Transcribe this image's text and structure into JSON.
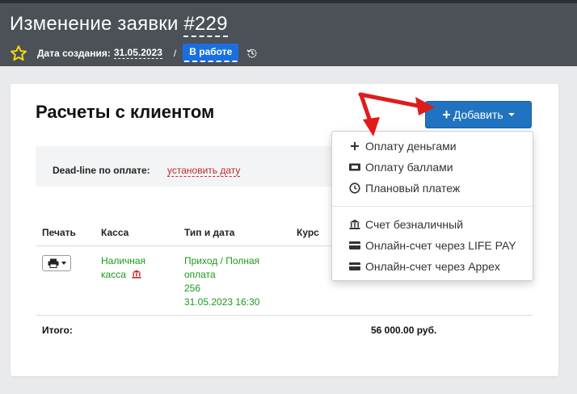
{
  "header": {
    "title_prefix": "Изменение заявки ",
    "title_number": "#229",
    "created_label": "Дата создания:",
    "created_date": "31.05.2023",
    "separator": "/",
    "status": "В работе",
    "icons": {
      "favorite": "star-icon",
      "history": "history-icon"
    }
  },
  "card": {
    "title": "Расчеты с клиентом",
    "add_button": "Добавить",
    "deadline_label": "Dead-line по оплате:",
    "deadline_link": "установить дату",
    "table": {
      "headers": [
        "Печать",
        "Касса",
        "Тип и дата",
        "Курс"
      ],
      "rows": [
        {
          "kassa_line1": "Наличная",
          "kassa_line2": "касса",
          "type_line1": "Приход / Полная",
          "type_line2": "оплата",
          "type_line3": "256",
          "type_line4": "31.05.2023 16:30"
        }
      ],
      "total_label": "Итого:",
      "total_value": "56 000.00 руб."
    }
  },
  "dropdown": {
    "items": [
      {
        "label": "Оплату деньгами",
        "icon": "plus-icon"
      },
      {
        "label": "Оплату баллами",
        "icon": "ticket-icon"
      },
      {
        "label": "Плановый платеж",
        "icon": "clock-icon"
      },
      {
        "label": "Счет безналичный",
        "icon": "bank-icon"
      },
      {
        "label": "Онлайн-счет через LIFE PAY",
        "icon": "credit-card-icon"
      },
      {
        "label": "Онлайн-счет через Appex",
        "icon": "credit-card-icon"
      }
    ]
  },
  "colors": {
    "header_bg": "#4b5157",
    "accent_blue": "#1f73c0",
    "status_blue": "#1a6fe0",
    "link_red": "#c62828",
    "green_text": "#1a9a1a",
    "arrow_red": "#e01b1b",
    "star_yellow": "#f5d90a"
  }
}
